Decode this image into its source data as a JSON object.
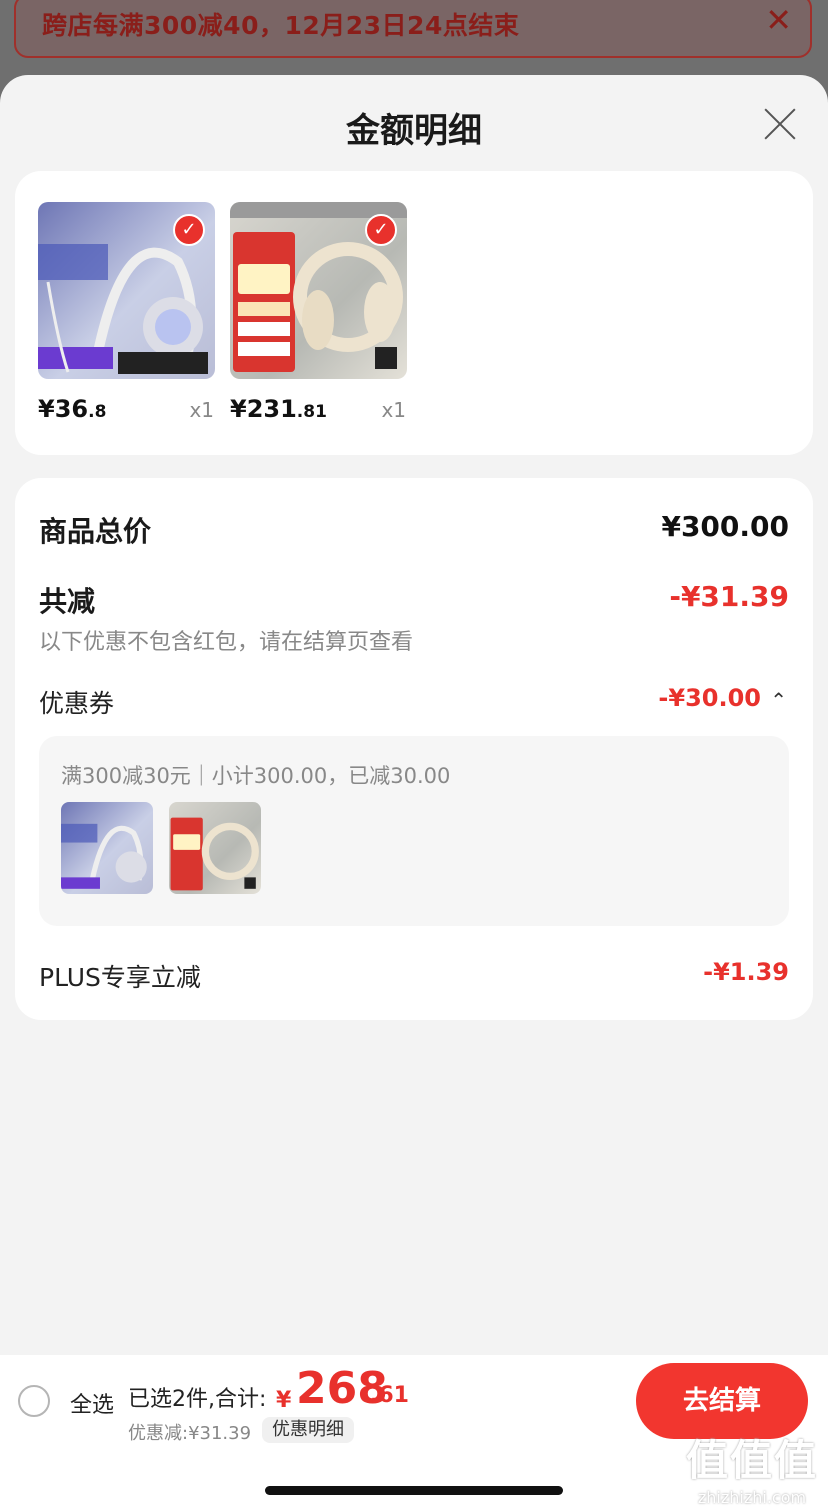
{
  "promo": {
    "text": "跨店每满300减40，12月23日24点结束",
    "close_glyph": "✕"
  },
  "sheet": {
    "title": "金额明细"
  },
  "products": [
    {
      "price_int": "¥36",
      "price_dec": ".8",
      "qty": "x1",
      "image": "gaming-headset-white",
      "check_glyph": "✓"
    },
    {
      "price_int": "¥231",
      "price_dec": ".81",
      "qty": "x1",
      "image": "edifier-headphones-beige",
      "check_glyph": "✓"
    }
  ],
  "summary": {
    "total_label": "商品总价",
    "total_value": "¥300.00",
    "reduce_label": "共减",
    "reduce_value": "-¥31.39",
    "reduce_note": "以下优惠不包含红包，请在结算页查看",
    "coupon_label": "优惠券",
    "coupon_value": "-¥30.00",
    "coupon_chevron": "⌃",
    "coupon_desc": "满300减30元｜小计300.00，已减30.00",
    "plus_label": "PLUS专享立减",
    "plus_value": "-¥1.39"
  },
  "bottom_bar": {
    "select_all": "全选",
    "selected_text": "已选2件,合计:",
    "total_yen": "¥",
    "total_main": "268",
    "total_dec": ".61",
    "discount_text": "优惠减:¥31.39",
    "detail_label": "优惠明细",
    "checkout_label": "去结算"
  },
  "watermark": {
    "big": "值值值",
    "small": "zhizhizhi.com"
  },
  "colors": {
    "accent_red": "#e8312c",
    "sheet_bg": "#f3f3f3"
  }
}
